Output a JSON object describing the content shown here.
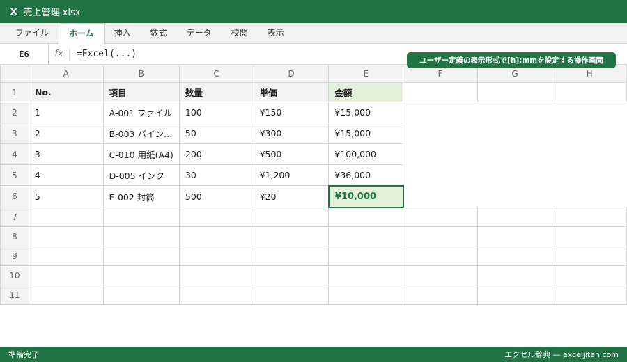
{
  "window": {
    "title": "売上管理.xlsx",
    "app_icon": "X"
  },
  "ribbon": {
    "tabs": [
      "ファイル",
      "ホーム",
      "挿入",
      "数式",
      "データ",
      "校閲",
      "表示"
    ],
    "active": "ホーム"
  },
  "formula_bar": {
    "name_box": "E6",
    "fx": "fx",
    "formula": "=Excel(...)"
  },
  "callout": "ユーザー定義の表示形式で[h]:mmを設定する操作画面",
  "sheet": {
    "columns": [
      "A",
      "B",
      "C",
      "D",
      "E",
      "F",
      "G",
      "H"
    ],
    "rows": [
      "1",
      "2",
      "3",
      "4",
      "5",
      "6",
      "7",
      "8",
      "9",
      "10",
      "11"
    ],
    "header": [
      "No.",
      "項目",
      "数量",
      "単価",
      "金額"
    ],
    "data": [
      [
        "1",
        "A-001 ファイル",
        "100",
        "¥150",
        "¥15,000"
      ],
      [
        "2",
        "B-003 バイン…",
        "50",
        "¥300",
        "¥15,000"
      ],
      [
        "3",
        "C-010 用紙(A4)",
        "200",
        "¥500",
        "¥100,000"
      ],
      [
        "4",
        "D-005 インク",
        "30",
        "¥1,200",
        "¥36,000"
      ],
      [
        "5",
        "E-002 封筒",
        "500",
        "¥20",
        "¥10,000"
      ]
    ],
    "active_cell": "E6"
  },
  "status": {
    "left": "準備完了",
    "right": "エクセル辞典 — exceljiten.com"
  },
  "colors": {
    "accent": "#217346",
    "highlight": "#e2efda"
  }
}
